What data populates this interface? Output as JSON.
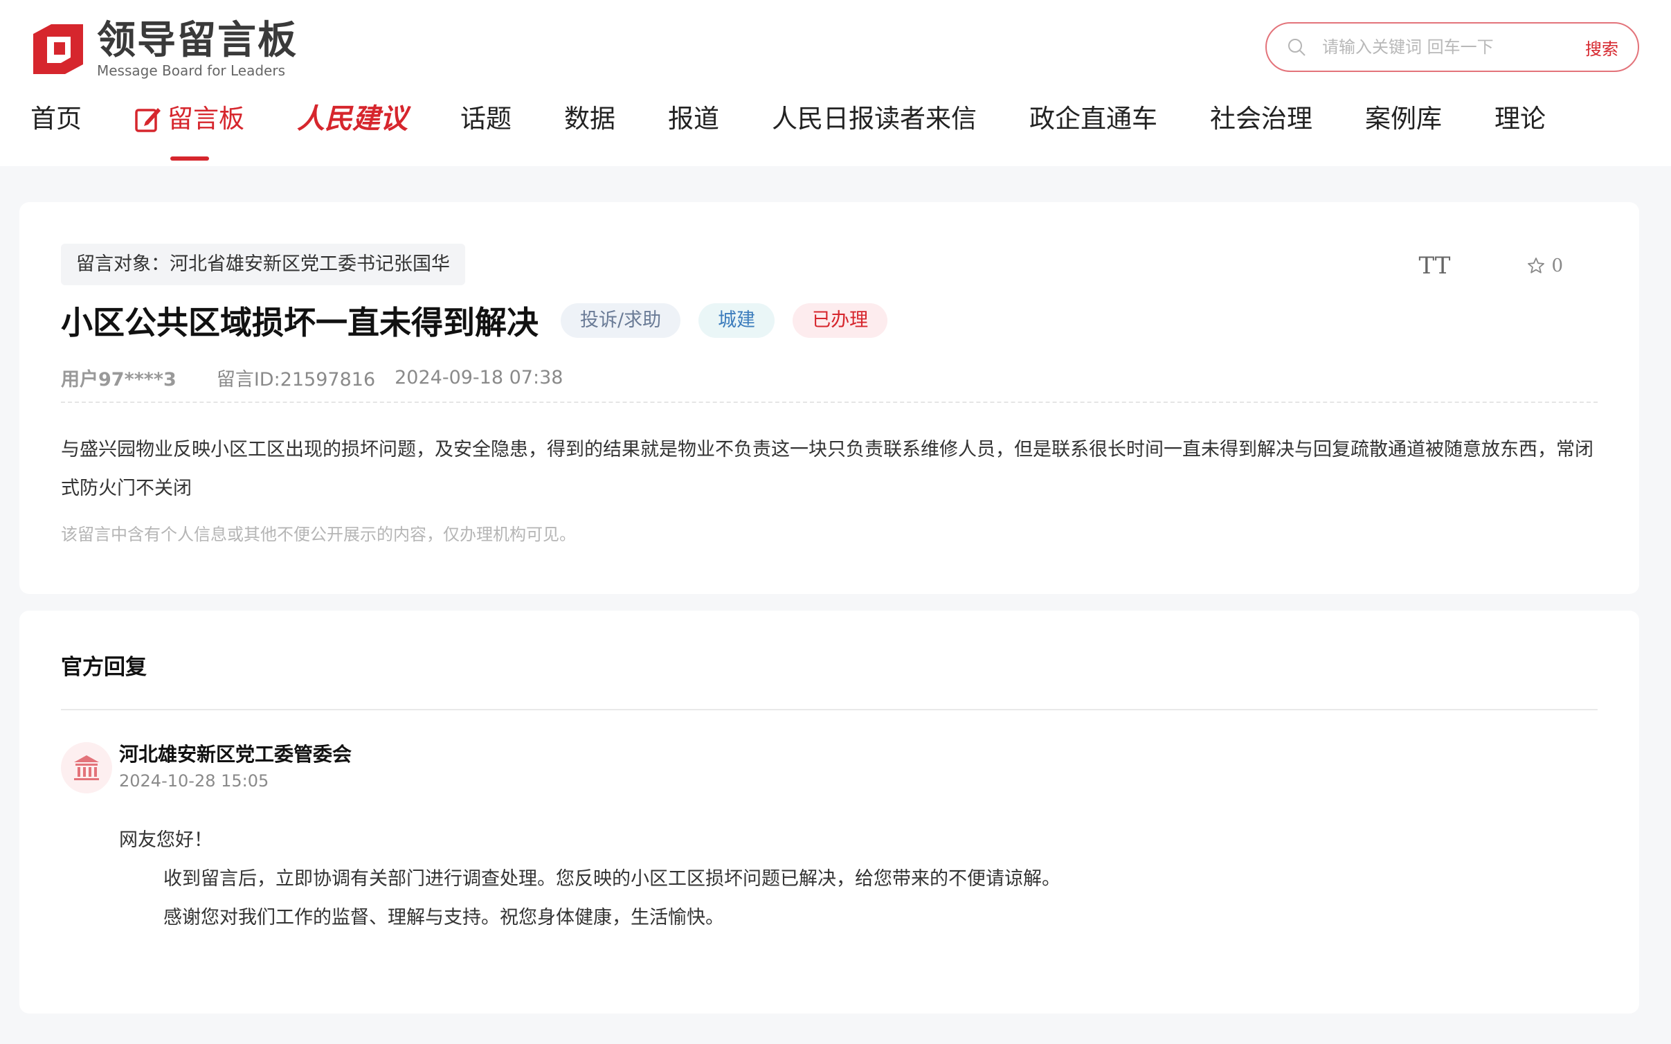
{
  "header": {
    "logo_title": "领导留言板",
    "logo_subtitle": "Message Board for Leaders",
    "search_placeholder": "请输入关键词 回车一下",
    "search_button": "搜索"
  },
  "nav": {
    "items": [
      {
        "label": "首页"
      },
      {
        "label": "留言板",
        "active": true
      },
      {
        "label": "人民建议"
      },
      {
        "label": "话题"
      },
      {
        "label": "数据"
      },
      {
        "label": "报道"
      },
      {
        "label": "人民日报读者来信"
      },
      {
        "label": "政企直通车"
      },
      {
        "label": "社会治理"
      },
      {
        "label": "案例库"
      },
      {
        "label": "理论"
      }
    ]
  },
  "message": {
    "target": "留言对象：河北省雄安新区党工委书记张国华",
    "font_tool": "TT",
    "favorite_count": "0",
    "title": "小区公共区域损坏一直未得到解决",
    "tags": {
      "type": "投诉/求助",
      "domain": "城建",
      "status": "已办理"
    },
    "user": "用户97****3",
    "message_id": "留言ID:21597816",
    "datetime": "2024-09-18 07:38",
    "body": "与盛兴园物业反映小区工区出现的损坏问题，及安全隐患，得到的结果就是物业不负责这一块只负责联系维修人员，但是联系很长时间一直未得到解决与回复疏散通道被随意放东西，常闭式防火门不关闭",
    "note": "该留言中含有个人信息或其他不便公开展示的内容，仅办理机构可见。"
  },
  "reply": {
    "heading": "官方回复",
    "org_name": "河北雄安新区党工委管委会",
    "datetime": "2024-10-28 15:05",
    "greeting": "网友您好！",
    "line1": "收到留言后，立即协调有关部门进行调查处理。您反映的小区工区损坏问题已解决，给您带来的不便请谅解。",
    "line2": "感谢您对我们工作的监督、理解与支持。祝您身体健康，生活愉快。"
  },
  "colors": {
    "accent": "#d6262d",
    "page_bg": "#f6f7f9"
  },
  "icons": [
    "logo-mark-icon",
    "search-icon",
    "edit-icon",
    "font-size-icon",
    "star-icon",
    "bank-icon"
  ]
}
